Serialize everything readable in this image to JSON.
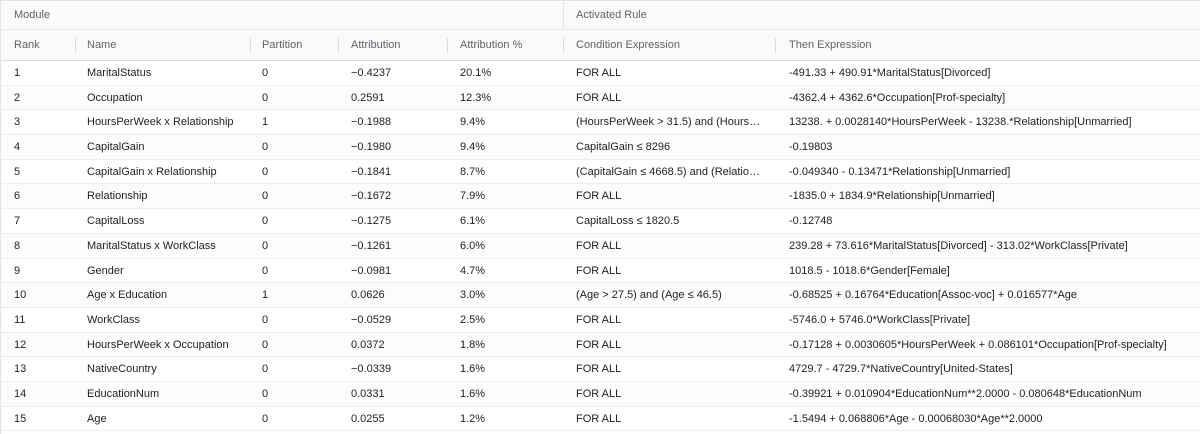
{
  "groups": {
    "module": "Module",
    "activated_rule": "Activated Rule"
  },
  "columns": {
    "rank": "Rank",
    "name": "Name",
    "partition": "Partition",
    "attribution": "Attribution",
    "attribution_pct": "Attribution %",
    "condition": "Condition Expression",
    "then": "Then Expression"
  },
  "rows": [
    {
      "rank": "1",
      "name": "MaritalStatus",
      "partition": "0",
      "attribution": "−0.4237",
      "pct": "20.1%",
      "condition": "FOR ALL",
      "then": "-491.33 + 490.91*MaritalStatus[Divorced]"
    },
    {
      "rank": "2",
      "name": "Occupation",
      "partition": "0",
      "attribution": "0.2591",
      "pct": "12.3%",
      "condition": "FOR ALL",
      "then": "-4362.4 + 4362.6*Occupation[Prof-specialty]"
    },
    {
      "rank": "3",
      "name": "HoursPerWeek x Relationship",
      "partition": "1",
      "attribution": "−0.1988",
      "pct": "9.4%",
      "condition": "(HoursPerWeek > 31.5) and (HoursPer...",
      "then": "13238. + 0.0028140*HoursPerWeek - 13238.*Relationship[Unmarried]"
    },
    {
      "rank": "4",
      "name": "CapitalGain",
      "partition": "0",
      "attribution": "−0.1980",
      "pct": "9.4%",
      "condition": "CapitalGain ≤ 8296",
      "then": "-0.19803"
    },
    {
      "rank": "5",
      "name": "CapitalGain x Relationship",
      "partition": "0",
      "attribution": "−0.1841",
      "pct": "8.7%",
      "condition": "(CapitalGain ≤ 4668.5) and (Relationshi...",
      "then": "-0.049340 - 0.13471*Relationship[Unmarried]"
    },
    {
      "rank": "6",
      "name": "Relationship",
      "partition": "0",
      "attribution": "−0.1672",
      "pct": "7.9%",
      "condition": "FOR ALL",
      "then": "-1835.0 + 1834.9*Relationship[Unmarried]"
    },
    {
      "rank": "7",
      "name": "CapitalLoss",
      "partition": "0",
      "attribution": "−0.1275",
      "pct": "6.1%",
      "condition": "CapitalLoss ≤ 1820.5",
      "then": "-0.12748"
    },
    {
      "rank": "8",
      "name": "MaritalStatus x WorkClass",
      "partition": "0",
      "attribution": "−0.1261",
      "pct": "6.0%",
      "condition": "FOR ALL",
      "then": "239.28 + 73.616*MaritalStatus[Divorced] - 313.02*WorkClass[Private]"
    },
    {
      "rank": "9",
      "name": "Gender",
      "partition": "0",
      "attribution": "−0.0981",
      "pct": "4.7%",
      "condition": "FOR ALL",
      "then": "1018.5 - 1018.6*Gender[Female]"
    },
    {
      "rank": "10",
      "name": "Age x Education",
      "partition": "1",
      "attribution": "0.0626",
      "pct": "3.0%",
      "condition": "(Age > 27.5) and (Age ≤ 46.5)",
      "then": "-0.68525 + 0.16764*Education[Assoc-voc] + 0.016577*Age"
    },
    {
      "rank": "11",
      "name": "WorkClass",
      "partition": "0",
      "attribution": "−0.0529",
      "pct": "2.5%",
      "condition": "FOR ALL",
      "then": "-5746.0 + 5746.0*WorkClass[Private]"
    },
    {
      "rank": "12",
      "name": "HoursPerWeek x Occupation",
      "partition": "0",
      "attribution": "0.0372",
      "pct": "1.8%",
      "condition": "FOR ALL",
      "then": "-0.17128 + 0.0030605*HoursPerWeek + 0.086101*Occupation[Prof-specialty]"
    },
    {
      "rank": "13",
      "name": "NativeCountry",
      "partition": "0",
      "attribution": "−0.0339",
      "pct": "1.6%",
      "condition": "FOR ALL",
      "then": "4729.7 - 4729.7*NativeCountry[United-States]"
    },
    {
      "rank": "14",
      "name": "EducationNum",
      "partition": "0",
      "attribution": "0.0331",
      "pct": "1.6%",
      "condition": "FOR ALL",
      "then": "-0.39921 + 0.010904*EducationNum**2.0000 - 0.080648*EducationNum"
    },
    {
      "rank": "15",
      "name": "Age",
      "partition": "0",
      "attribution": "0.0255",
      "pct": "1.2%",
      "condition": "FOR ALL",
      "then": "-1.5494 + 0.068806*Age - 0.00068030*Age**2.0000"
    }
  ]
}
